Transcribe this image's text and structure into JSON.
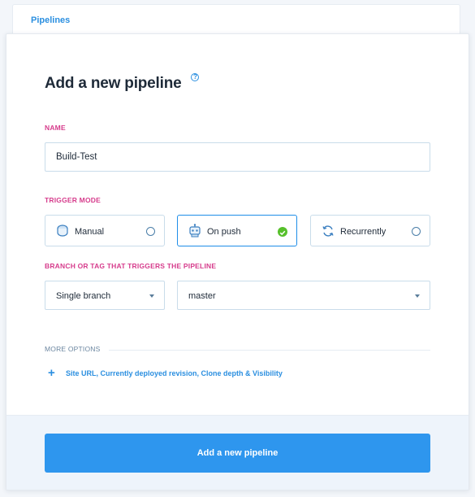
{
  "breadcrumb": {
    "label": "Pipelines"
  },
  "modal": {
    "title": "Add a new pipeline",
    "help_icon": "question-circle-icon"
  },
  "name_section": {
    "label": "NAME",
    "input_value": "Build-Test"
  },
  "trigger_section": {
    "label": "TRIGGER MODE",
    "options": [
      {
        "label": "Manual",
        "icon": "manual-icon",
        "selected": false
      },
      {
        "label": "On push",
        "icon": "robot-icon",
        "selected": true
      },
      {
        "label": "Recurrently",
        "icon": "refresh-icon",
        "selected": false
      }
    ]
  },
  "branch_section": {
    "label": "BRANCH OR TAG THAT TRIGGERS THE PIPELINE",
    "mode_select": "Single branch",
    "branch_select": "master"
  },
  "more_options": {
    "label": "MORE OPTIONS",
    "link_text": "Site URL, Currently deployed revision, Clone depth & Visibility"
  },
  "footer": {
    "submit_label": "Add a new pipeline"
  },
  "colors": {
    "accent": "#2e96ee",
    "section_label": "#d63c8c",
    "selected_check": "#56c02b"
  }
}
